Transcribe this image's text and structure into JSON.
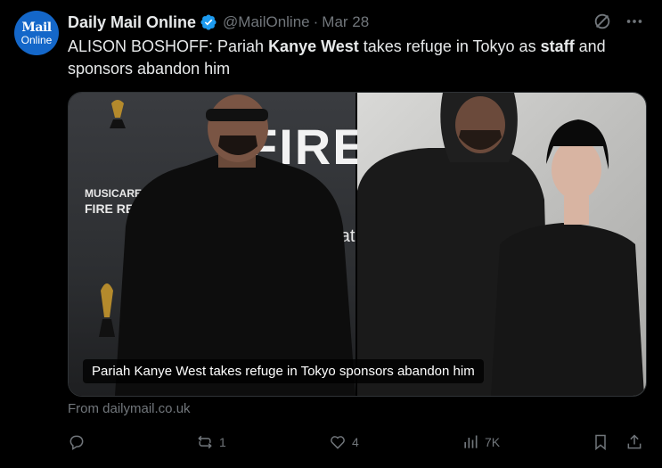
{
  "account": {
    "avatar_line1": "Mail",
    "avatar_line2": "Online",
    "display_name": "Daily Mail Online",
    "handle": "@MailOnline",
    "separator": "·",
    "date": "Mar 28"
  },
  "tweet": {
    "text_part1": "ALISON BOSHOFF: Pariah ",
    "bold1": "Kanye West",
    "text_part2": " takes refuge in Tokyo as ",
    "bold2": "staff",
    "text_part3": " and sponsors abandon him"
  },
  "media": {
    "left_banner_1": "MUSICARES",
    "left_banner_2": "FIRE RELIEF",
    "left_banner_big": "FIRE",
    "left_banner_donate": "Donat",
    "caption": "Pariah Kanye West takes refuge in Tokyo sponsors abandon him"
  },
  "card_source": "From dailymail.co.uk",
  "actions": {
    "reply_count": "",
    "retweet_count": "1",
    "like_count": "4",
    "view_count": "7K"
  },
  "colors": {
    "background": "#000000",
    "text_primary": "#e7e9ea",
    "text_secondary": "#71767b",
    "verified": "#1d9bf0",
    "avatar": "#1467c9"
  }
}
